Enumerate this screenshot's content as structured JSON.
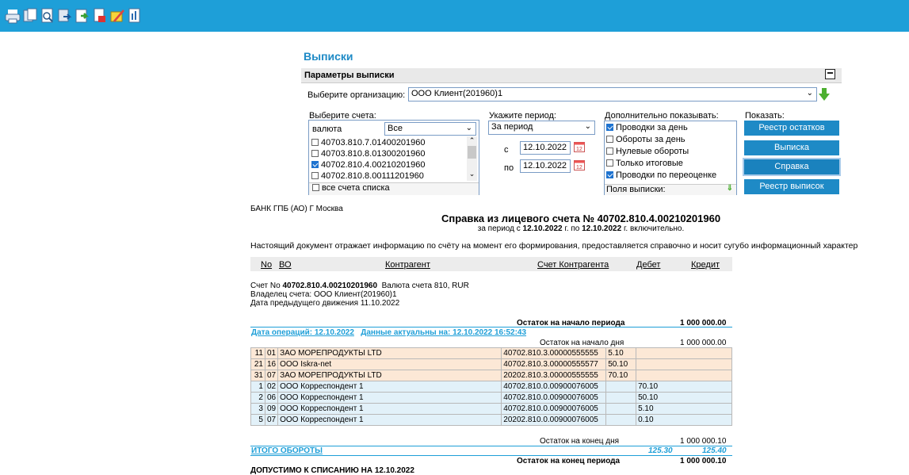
{
  "toolbar": {
    "icons": [
      "print-icon",
      "copy-icon",
      "preview-icon",
      "export-icon",
      "send-icon",
      "pdf-icon",
      "note-icon",
      "report-icon"
    ]
  },
  "section_title": "Выписки",
  "params": {
    "title": "Параметры выписки",
    "org_label": "Выберите организацию:",
    "org_value": "ООО Клиент(201960)1",
    "accounts_label": "Выберите счета:",
    "currency_label": "валюта",
    "currency_value": "Все",
    "accounts": [
      {
        "number": "40703.810.7.01400201960",
        "checked": false
      },
      {
        "number": "40703.810.8.01300201960",
        "checked": false
      },
      {
        "number": "40702.810.4.00210201960",
        "checked": true
      },
      {
        "number": "40702.810.8.00111201960",
        "checked": false
      }
    ],
    "all_accounts": "все счета списка",
    "period_label": "Укажите период:",
    "period_value": "За период",
    "from_label": "с",
    "from_date": "12.10.2022",
    "to_label": "по",
    "to_date": "12.10.2022",
    "extra_label": "Дополнительно показывать:",
    "extras": [
      {
        "label": "Проводки за день",
        "checked": true
      },
      {
        "label": "Обороты за день",
        "checked": false
      },
      {
        "label": "Нулевые обороты",
        "checked": false
      },
      {
        "label": "Только итоговые",
        "checked": false
      },
      {
        "label": "Проводки по переоценке",
        "checked": true
      }
    ],
    "fields_label": "Поля выписки:",
    "show_label": "Показать:",
    "buttons": [
      "Реестр остатков",
      "Выписка",
      "Справка",
      "Реестр выписок"
    ]
  },
  "doc": {
    "bank": "БАНК ГПБ (АО) Г Москва",
    "title": "Справка из лицевого счета № 40702.810.4.00210201960",
    "period_prefix": "за период с ",
    "period_from": "12.10.2022",
    "period_mid": " г. по ",
    "period_to": "12.10.2022",
    "period_suffix": " г. включительно.",
    "disclaimer": "Настоящий документ отражает информацию по счёту на момент его формирования, предоставляется справочно и носит сугубо информационный характер",
    "columns": [
      "No",
      "ВО",
      "Контрагент",
      "Счет Контрагента",
      "Дебет",
      "Кредит"
    ],
    "acc_prefix": "Счет No ",
    "acc_number": "40702.810.4.00210201960",
    "acc_currency": "Валюта счета 810, RUR",
    "owner": "Владелец счета: ООО Клиент(201960)1",
    "prev_move": "Дата предыдущего движения 11.10.2022",
    "opening_label": "Остаток на начало периода",
    "opening_value": "1 000 000.00",
    "ops_date": "Дата операций: 12.10.2022",
    "actual": "Данные актуальны на: 12.10.2022 16:52:43",
    "day_open_label": "Остаток на начало дня",
    "day_open_value": "1 000 000.00",
    "rows": [
      {
        "no": "11",
        "vo": "01",
        "name": "ЗАО МОРЕПРОДУКТЫ LTD",
        "acc": "40702.810.3.00000555555",
        "debit": "5.10",
        "credit": "",
        "kind": "beige"
      },
      {
        "no": "21",
        "vo": "16",
        "name": "ООО Iskra-net",
        "acc": "40702.810.3.00000555577",
        "debit": "50.10",
        "credit": "",
        "kind": "beige"
      },
      {
        "no": "31",
        "vo": "07",
        "name": "ЗАО МОРЕПРОДУКТЫ LTD",
        "acc": "20202.810.3.00000555555",
        "debit": "70.10",
        "credit": "",
        "kind": "beige"
      },
      {
        "no": "1",
        "vo": "02",
        "name": "ООО Корреспондент 1",
        "acc": "40702.810.0.00900076005",
        "debit": "",
        "credit": "70.10",
        "kind": "blue"
      },
      {
        "no": "2",
        "vo": "06",
        "name": "ООО Корреспондент 1",
        "acc": "40702.810.0.00900076005",
        "debit": "",
        "credit": "50.10",
        "kind": "blue"
      },
      {
        "no": "3",
        "vo": "09",
        "name": "ООО Корреспондент 1",
        "acc": "40702.810.0.00900076005",
        "debit": "",
        "credit": "5.10",
        "kind": "blue"
      },
      {
        "no": "5",
        "vo": "07",
        "name": "ООО Корреспондент 1",
        "acc": "20202.810.0.00900076005",
        "debit": "",
        "credit": "0.10",
        "kind": "blue"
      }
    ],
    "day_close_label": "Остаток на конец дня",
    "day_close_value": "1 000 000.10",
    "totals_label": "ИТОГО ОБОРОТЫ",
    "totals_debit": "125.30",
    "totals_credit": "125.40",
    "closing_label": "Остаток на конец периода",
    "closing_value": "1 000 000.10",
    "footer": "ДОПУСТИМО К СПИСАНИЮ НА 12.10.2022"
  }
}
